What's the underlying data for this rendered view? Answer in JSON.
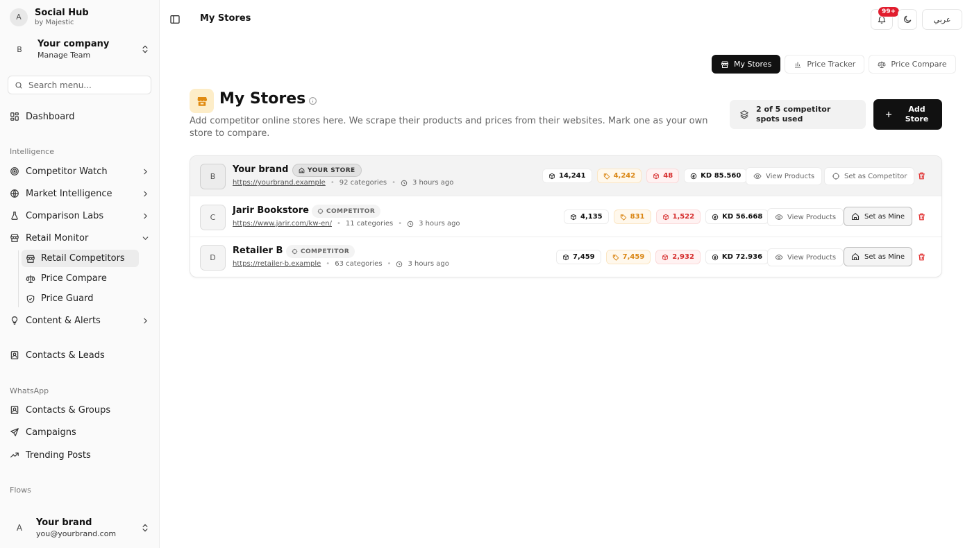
{
  "app": {
    "name": "Social Hub",
    "sub": "by Majestic",
    "initial": "A"
  },
  "company": {
    "initial": "B",
    "name": "Your company",
    "sub": "Manage Team"
  },
  "search": {
    "placeholder": "Search menu..."
  },
  "nav": {
    "dashboard": "Dashboard",
    "section_intelligence": "Intelligence",
    "competitor_watch": "Competitor Watch",
    "market_intelligence": "Market Intelligence",
    "comparison_labs": "Comparison Labs",
    "retail_monitor": "Retail Monitor",
    "retail_competitors": "Retail Competitors",
    "price_compare": "Price Compare",
    "price_guard": "Price Guard",
    "content_alerts": "Content & Alerts",
    "contacts_leads": "Contacts & Leads",
    "section_whatsapp": "WhatsApp",
    "contacts_groups": "Contacts & Groups",
    "campaigns": "Campaigns",
    "trending_posts": "Trending Posts",
    "section_flows": "Flows"
  },
  "user": {
    "initial": "A",
    "name": "Your brand",
    "email": "you@yourbrand.com"
  },
  "header": {
    "title": "My Stores",
    "notif_count": "99+",
    "lang": "عربي"
  },
  "tabs": [
    {
      "label": "My Stores",
      "icon": "store-icon",
      "active": true
    },
    {
      "label": "Price Tracker",
      "icon": "bar-chart-icon",
      "active": false
    },
    {
      "label": "Price Compare",
      "icon": "scale-icon",
      "active": false
    }
  ],
  "page": {
    "title": "My Stores",
    "description": "Add competitor online stores here. We scrape their products and prices from their websites. Mark one as your own store to compare.",
    "spots": "2 of 5 competitor spots used",
    "add_button": "Add Store"
  },
  "colors": {
    "accent": "#111111",
    "orange": "#d98512",
    "red": "#d52a2a",
    "icon_bg": "#fdedc8",
    "icon_fg": "#e08a10"
  },
  "actions": {
    "view": "View Products",
    "set_competitor": "Set as Competitor",
    "set_mine": "Set as Mine"
  },
  "stores": [
    {
      "initial": "B",
      "name": "Your brand",
      "badge": "YOUR STORE",
      "url": "https://yourbrand.example",
      "categories": "92 categories",
      "time": "3 hours ago",
      "products": "14,241",
      "tagged": "4,242",
      "boxes": "48",
      "value": "KD 85.560"
    },
    {
      "initial": "C",
      "name": "Jarir Bookstore",
      "badge": "COMPETITOR",
      "url": "https://www.jarir.com/kw-en/",
      "categories": "11 categories",
      "time": "3 hours ago",
      "products": "4,135",
      "tagged": "831",
      "boxes": "1,522",
      "value": "KD 56.668"
    },
    {
      "initial": "D",
      "name": "Retailer B",
      "badge": "COMPETITOR",
      "url": "https://retailer-b.example",
      "categories": "63 categories",
      "time": "3 hours ago",
      "products": "7,459",
      "tagged": "7,459",
      "boxes": "2,932",
      "value": "KD 72.936"
    }
  ]
}
